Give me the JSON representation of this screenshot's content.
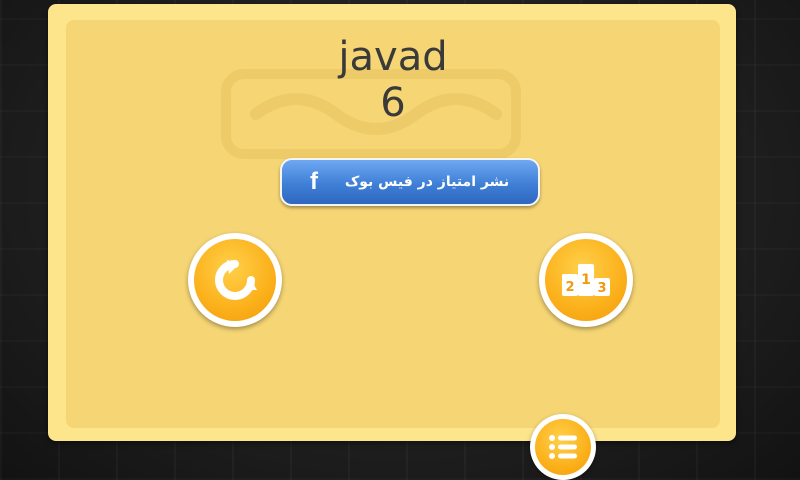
{
  "result": {
    "player_name": "javad",
    "score": "6"
  },
  "share_button": {
    "label": "نشر امتیاز در فیس بوک",
    "icon": "facebook-icon",
    "icon_glyph": "f"
  },
  "actions": {
    "replay_icon": "replay-icon",
    "leaderboard_icon": "podium-icon",
    "menu_icon": "list-menu-icon"
  },
  "colors": {
    "panel": "#fde58c",
    "panel_inner": "#f6d574",
    "button_orange": "#fbb01a",
    "facebook_blue": "#3f7fd6"
  }
}
